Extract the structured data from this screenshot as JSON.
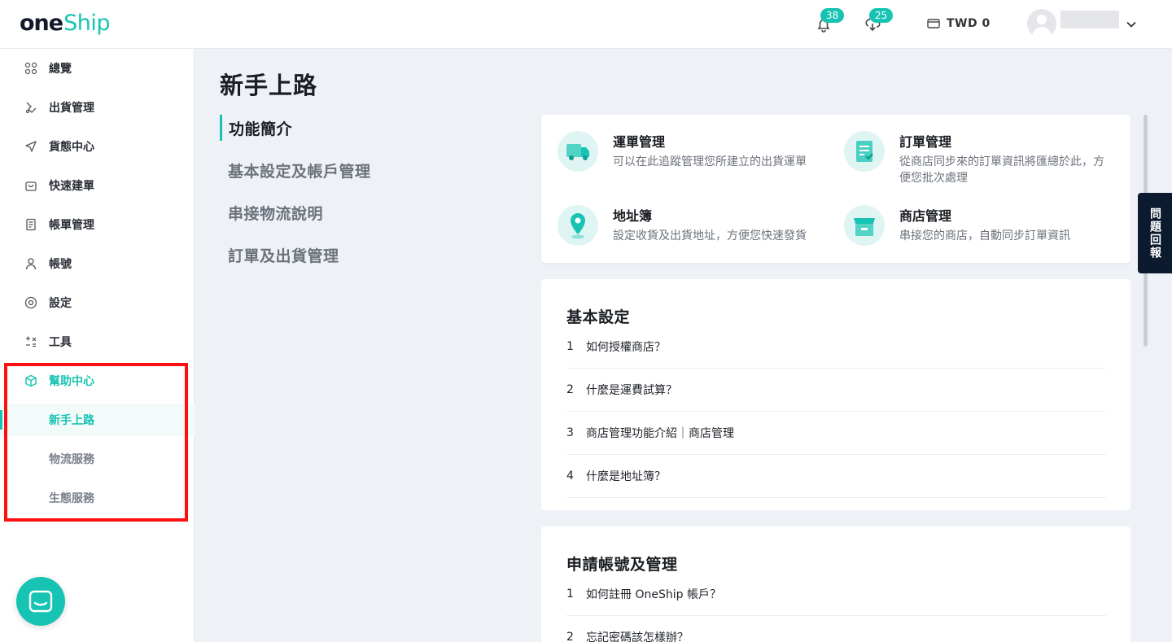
{
  "header": {
    "logo_one": "one",
    "logo_ship": "Ship",
    "notifications_count": "38",
    "downloads_count": "25",
    "wallet_label": "TWD 0"
  },
  "sidebar": {
    "items": [
      {
        "label": "總覽",
        "icon": "grid-icon"
      },
      {
        "label": "出貨管理",
        "icon": "shipment-icon"
      },
      {
        "label": "貨態中心",
        "icon": "send-icon"
      },
      {
        "label": "快速建單",
        "icon": "bag-icon"
      },
      {
        "label": "帳單管理",
        "icon": "bill-icon"
      },
      {
        "label": "帳號",
        "icon": "user-icon"
      },
      {
        "label": "設定",
        "icon": "settings-icon"
      },
      {
        "label": "工具",
        "icon": "tools-icon"
      },
      {
        "label": "幫助中心",
        "icon": "box-icon"
      }
    ],
    "help_sub": [
      "新手上路",
      "物流服務",
      "生態服務"
    ]
  },
  "main": {
    "page_title": "新手上路",
    "sections": [
      "功能簡介",
      "基本設定及帳戶管理",
      "串接物流說明",
      "訂單及出貨管理"
    ],
    "features": [
      {
        "title": "運單管理",
        "desc": "可以在此追蹤管理您所建立的出貨運單",
        "icon": "truck-icon"
      },
      {
        "title": "訂單管理",
        "desc": "從商店同步來的訂單資訊將匯總於此，方便您批次處理",
        "icon": "order-icon"
      },
      {
        "title": "地址簿",
        "desc": "設定收貨及出貨地址，方便您快速發貨",
        "icon": "location-pin-icon"
      },
      {
        "title": "商店管理",
        "desc": "串接您的商店，自動同步訂單資訊",
        "icon": "store-icon"
      }
    ],
    "basic_settings": {
      "title": "基本設定",
      "items": [
        {
          "num": "1",
          "text": "如何授權商店？"
        },
        {
          "num": "2",
          "text": "什麼是運費試算？"
        },
        {
          "num": "3",
          "text": "商店管理功能介紹｜商店管理"
        },
        {
          "num": "4",
          "text": "什麼是地址簿？"
        }
      ]
    },
    "account_settings": {
      "title": "申請帳號及管理",
      "items": [
        {
          "num": "1",
          "text": "如何註冊 OneShip 帳戶？"
        },
        {
          "num": "2",
          "text": "忘記密碼該怎樣辦？"
        }
      ]
    }
  },
  "feedback_label": "問題回報",
  "colors": {
    "accent": "#17c3b2",
    "highlight": "#ff1010",
    "feedback_bg": "#0b1a2e"
  }
}
